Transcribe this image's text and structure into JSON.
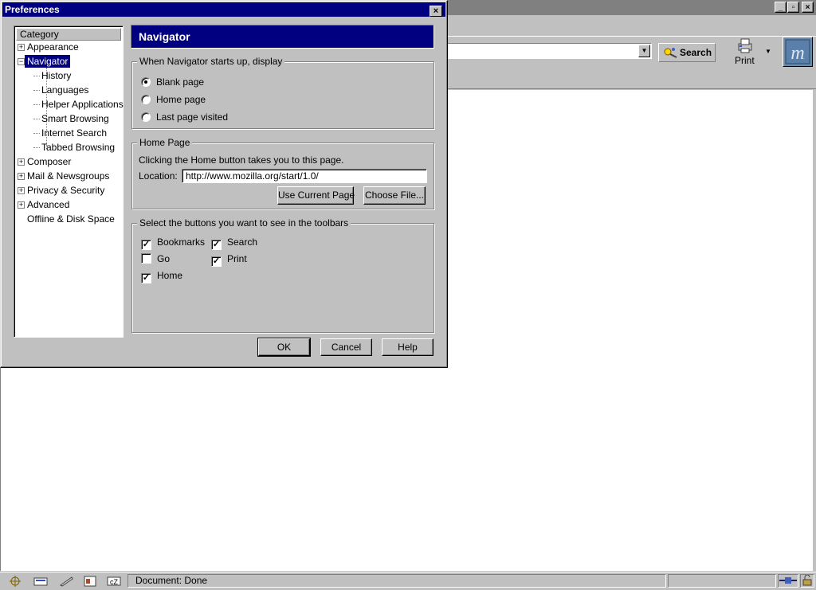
{
  "browser": {
    "search_label": "Search",
    "print_label": "Print"
  },
  "status": {
    "text": "Document: Done"
  },
  "dialog": {
    "title": "Preferences",
    "category_header": "Category",
    "tree": [
      {
        "label": "Appearance",
        "expander": "+"
      },
      {
        "label": "Navigator",
        "expander": "−",
        "selected": true
      },
      {
        "label": "History"
      },
      {
        "label": "Languages"
      },
      {
        "label": "Helper Applications"
      },
      {
        "label": "Smart Browsing"
      },
      {
        "label": "Internet Search"
      },
      {
        "label": "Tabbed Browsing"
      },
      {
        "label": "Composer",
        "expander": "+"
      },
      {
        "label": "Mail & Newsgroups",
        "expander": "+"
      },
      {
        "label": "Privacy & Security",
        "expander": "+"
      },
      {
        "label": "Advanced",
        "expander": "+"
      },
      {
        "label": "Offline & Disk Space"
      }
    ],
    "panel_title": "Navigator",
    "startup": {
      "legend": "When Navigator starts up, display",
      "options": [
        "Blank page",
        "Home page",
        "Last page visited"
      ],
      "selected": "Blank page"
    },
    "home_page": {
      "legend": "Home Page",
      "description": "Clicking the Home button takes you to this page.",
      "location_label": "Location:",
      "location_value": "http://www.mozilla.org/start/1.0/",
      "use_current_label": "Use Current Page",
      "choose_file_label": "Choose File..."
    },
    "toolbar_buttons": {
      "legend": "Select the buttons you want to see in the toolbars",
      "items": [
        {
          "label": "Bookmarks",
          "checked": true
        },
        {
          "label": "Go",
          "checked": false
        },
        {
          "label": "Home",
          "checked": true
        },
        {
          "label": "Search",
          "checked": true
        },
        {
          "label": "Print",
          "checked": true
        }
      ]
    },
    "ok_label": "OK",
    "cancel_label": "Cancel",
    "help_label": "Help"
  }
}
